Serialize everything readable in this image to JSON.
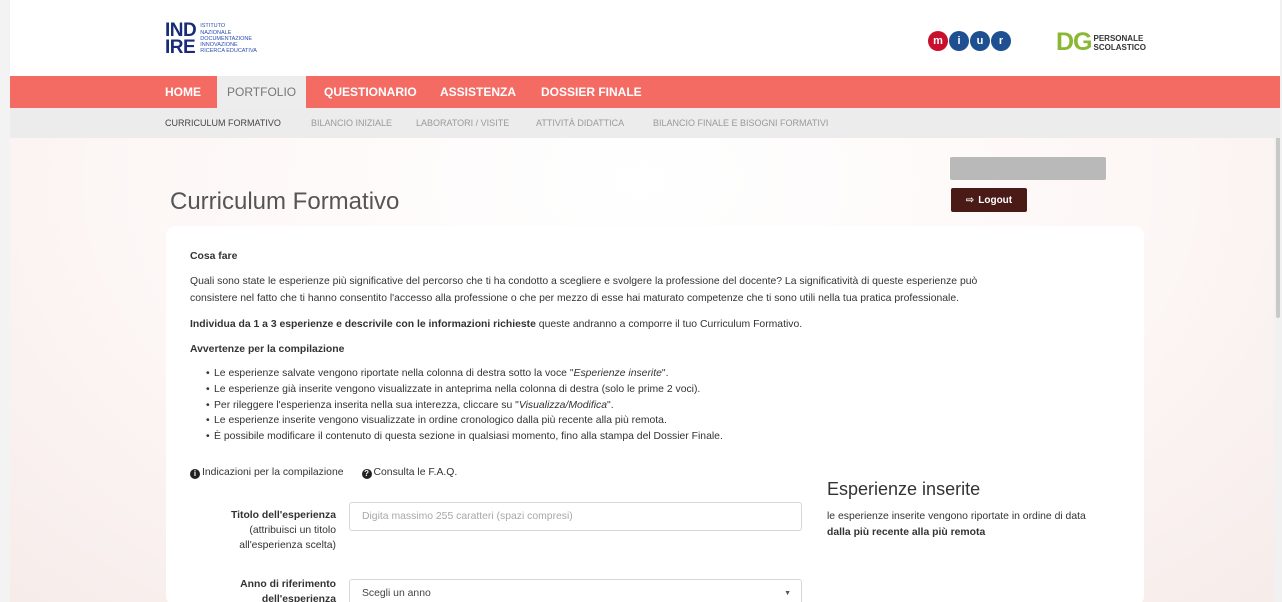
{
  "header": {
    "indire_letters": [
      "IND",
      "IRE"
    ],
    "indire_sub": [
      "Istituto",
      "Nazionale",
      "Documentazione",
      "Innovazione",
      "Ricerca Educativa"
    ],
    "miur_letters": [
      "m",
      "i",
      "u",
      "r"
    ],
    "miur_colors": [
      "#c8102e",
      "#1d4f91",
      "#1d4f91",
      "#1d4f91"
    ],
    "dg_letters": "DG",
    "dg_sub": [
      "PERSONALE",
      "SCOLASTICO"
    ]
  },
  "nav": {
    "items": [
      "HOME",
      "PORTFOLIO",
      "QUESTIONARIO",
      "ASSISTENZA",
      "DOSSIER FINALE"
    ],
    "active": "PORTFOLIO",
    "color": "#f46b64"
  },
  "subnav": {
    "items": [
      "CURRICULUM FORMATIVO",
      "BILANCIO INIZIALE",
      "LABORATORI / VISITE",
      "ATTIVITÀ DIDATTICA",
      "BILANCIO FINALE E BISOGNI FORMATIVI"
    ],
    "active": "CURRICULUM FORMATIVO"
  },
  "user": {
    "logout_icon": "sign-out-icon",
    "logout_label": "Logout",
    "logout_color": "#4a1a16"
  },
  "page": {
    "title": "Curriculum Formativo"
  },
  "content": {
    "cosa_fare_title": "Cosa fare",
    "intro_line1": "Quali sono state le esperienze più significative del percorso che ti ha condotto a scegliere e svolgere la professione del docente? La significatività di queste esperienze può",
    "intro_line2": "consistere nel fatto che ti hanno consentito l'accesso alla professione o che per mezzo di esse hai maturato competenze che ti sono utili nella tua pratica professionale.",
    "individua_bold": "Individua da 1 a 3 esperienze e descrivile con le informazioni richieste",
    "individua_rest": " queste andranno a comporre il tuo Curriculum Formativo.",
    "avvertenze_title": "Avvertenze per la compilazione",
    "bullets": [
      {
        "pre": "Le esperienze salvate vengono riportate nella colonna di destra sotto la voce \"",
        "em": "Esperienze inserite",
        "post": "\"."
      },
      {
        "pre": "Le esperienze già inserite vengono visualizzate in anteprima nella colonna di destra (solo le prime 2 voci).",
        "em": "",
        "post": ""
      },
      {
        "pre": "Per rileggere l'esperienza inserita nella sua interezza, cliccare su \"",
        "em": "Visualizza/Modifica",
        "post": "\"."
      },
      {
        "pre": "Le esperienze inserite vengono visualizzate in ordine cronologico dalla più recente alla più remota.",
        "em": "",
        "post": ""
      },
      {
        "pre": "È possibile modificare il contenuto di questa sezione in qualsiasi momento, fino alla stampa del Dossier Finale.",
        "em": "",
        "post": ""
      }
    ],
    "link_indicazioni": "Indicazioni per la compilazione",
    "link_faq": "Consulta le F.A.Q."
  },
  "form": {
    "titolo_label": "Titolo dell'esperienza",
    "titolo_hint": [
      "(attribuisci un titolo",
      "all'esperienza scelta)"
    ],
    "titolo_placeholder": "Digita massimo 255 caratteri (spazi compresi)",
    "anno_label": [
      "Anno di riferimento",
      "dell'esperienza"
    ],
    "anno_selected": "Scegli un anno"
  },
  "esperienze": {
    "title": "Esperienze inserite",
    "desc1": "le esperienze inserite vengono riportate in ordine di data",
    "desc2": "dalla più recente alla più remota"
  }
}
